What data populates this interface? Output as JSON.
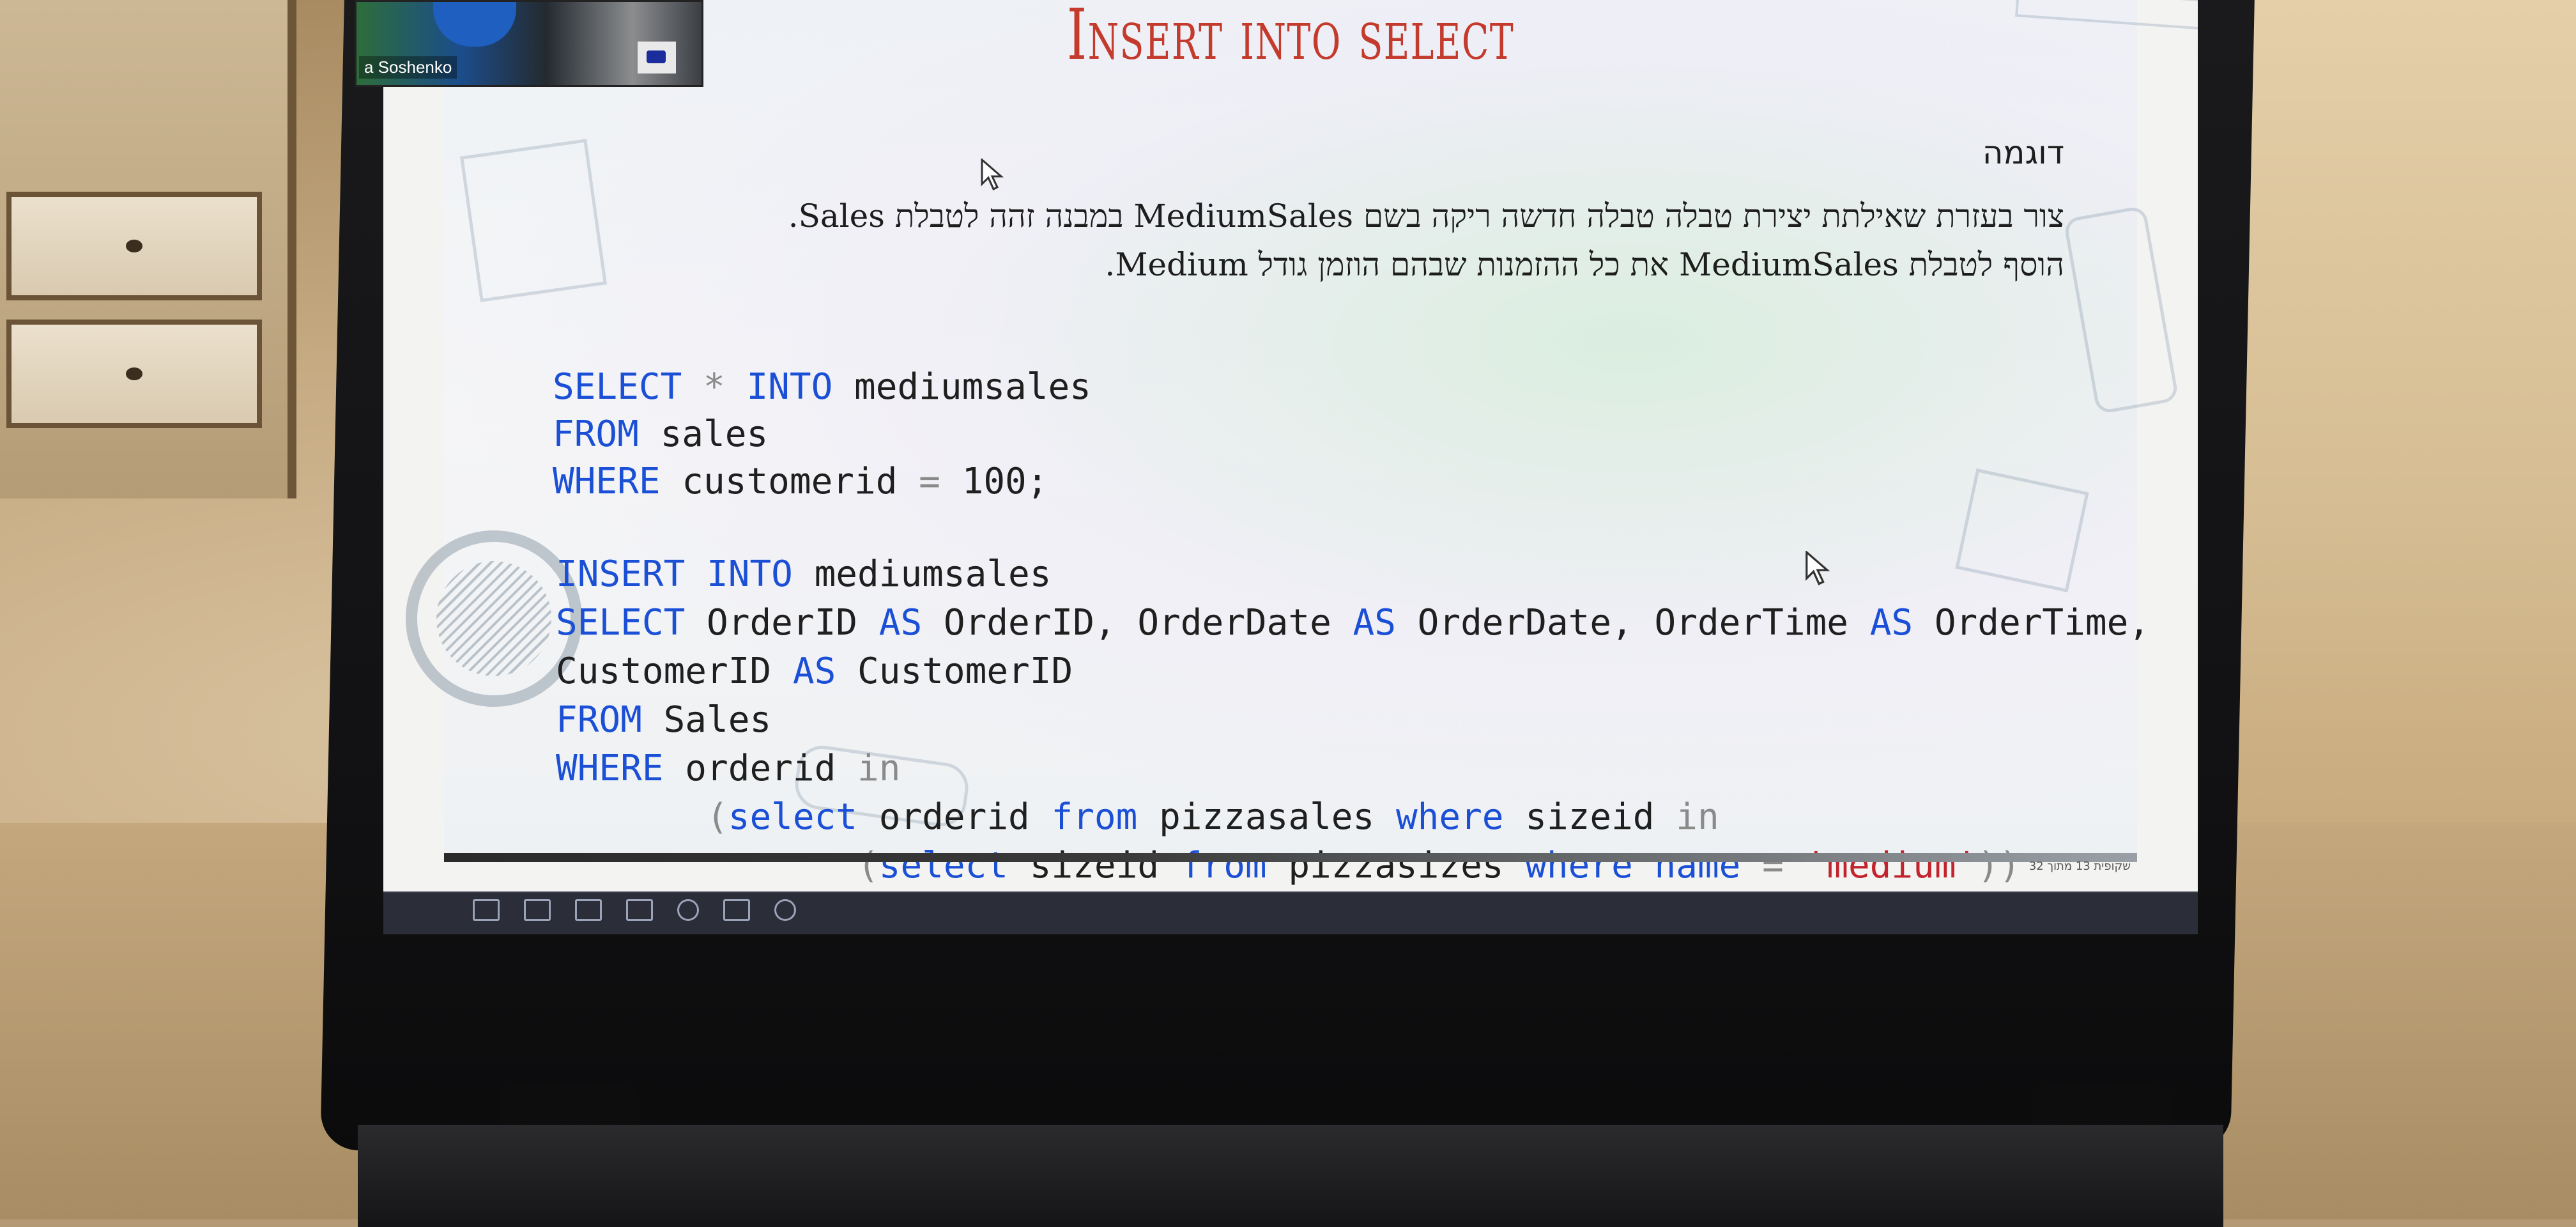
{
  "webcam": {
    "participant_name": "a Soshenko"
  },
  "slide": {
    "title": "Insert into select",
    "subtitle": "דוגמה",
    "description_line1": "צור בעזרת שאילתת יצירת טבלה טבלה חדשה ריקה  בשם MediumSales במבנה זהה לטבלת Sales.",
    "description_line2": "הוסף לטבלת MediumSales את כל ההזמנות שבהם הוזמן גודל Medium.",
    "code_block_1": {
      "line1_kw1": "SELECT",
      "line1_op": "*",
      "line1_kw2": "INTO",
      "line1_rest": "mediumsales",
      "line2_kw": "FROM",
      "line2_rest": "sales",
      "line3_kw": "WHERE",
      "line3_rest1": "customerid",
      "line3_op": "=",
      "line3_rest2": "100;"
    },
    "code_block_2": {
      "l1_kw1": "INSERT",
      "l1_kw2": "INTO",
      "l1_rest": "mediumsales",
      "l2_kw1": "SELECT",
      "l2_t1": "OrderID",
      "l2_kw2": "AS",
      "l2_t2": "OrderID,",
      "l2_t3": "OrderDate",
      "l2_kw3": "AS",
      "l2_t4": "OrderDate,",
      "l2_t5": "OrderTime",
      "l2_kw4": "AS",
      "l2_t6": "OrderTime,",
      "l3_t1": "CustomerID",
      "l3_kw": "AS",
      "l3_t2": "CustomerID",
      "l4_kw": "FROM",
      "l4_rest": "Sales",
      "l5_kw": "WHERE",
      "l5_rest": "orderid",
      "l5_op": "in",
      "l6_paren": "(",
      "l6_kw1": "select",
      "l6_t1": "orderid",
      "l6_kw2": "from",
      "l6_t2": "pizzasales",
      "l6_kw3": "where",
      "l6_t3": "sizeid",
      "l6_op": "in",
      "l7_paren": "(",
      "l7_kw1": "select",
      "l7_t1": "sizeid",
      "l7_kw2": "from",
      "l7_t2": "pizzasizes",
      "l7_kw3": "where",
      "l7_kw4": "name",
      "l7_op": "=",
      "l7_str": "'medium'",
      "l7_close": "))"
    },
    "slide_counter": "שקופית 13 מתוך 32"
  },
  "colors": {
    "title": "#c43a2c",
    "keyword": "#1a4fd6",
    "string": "#c3232c",
    "operator": "#8a8a8a",
    "statusbar": "#2b2d38"
  },
  "statusbar_icons": [
    "notes-icon",
    "reading-view-icon",
    "slide-sorter-icon",
    "normal-view-icon",
    "slideshow-play-icon",
    "presenter-icon",
    "previous-icon"
  ]
}
